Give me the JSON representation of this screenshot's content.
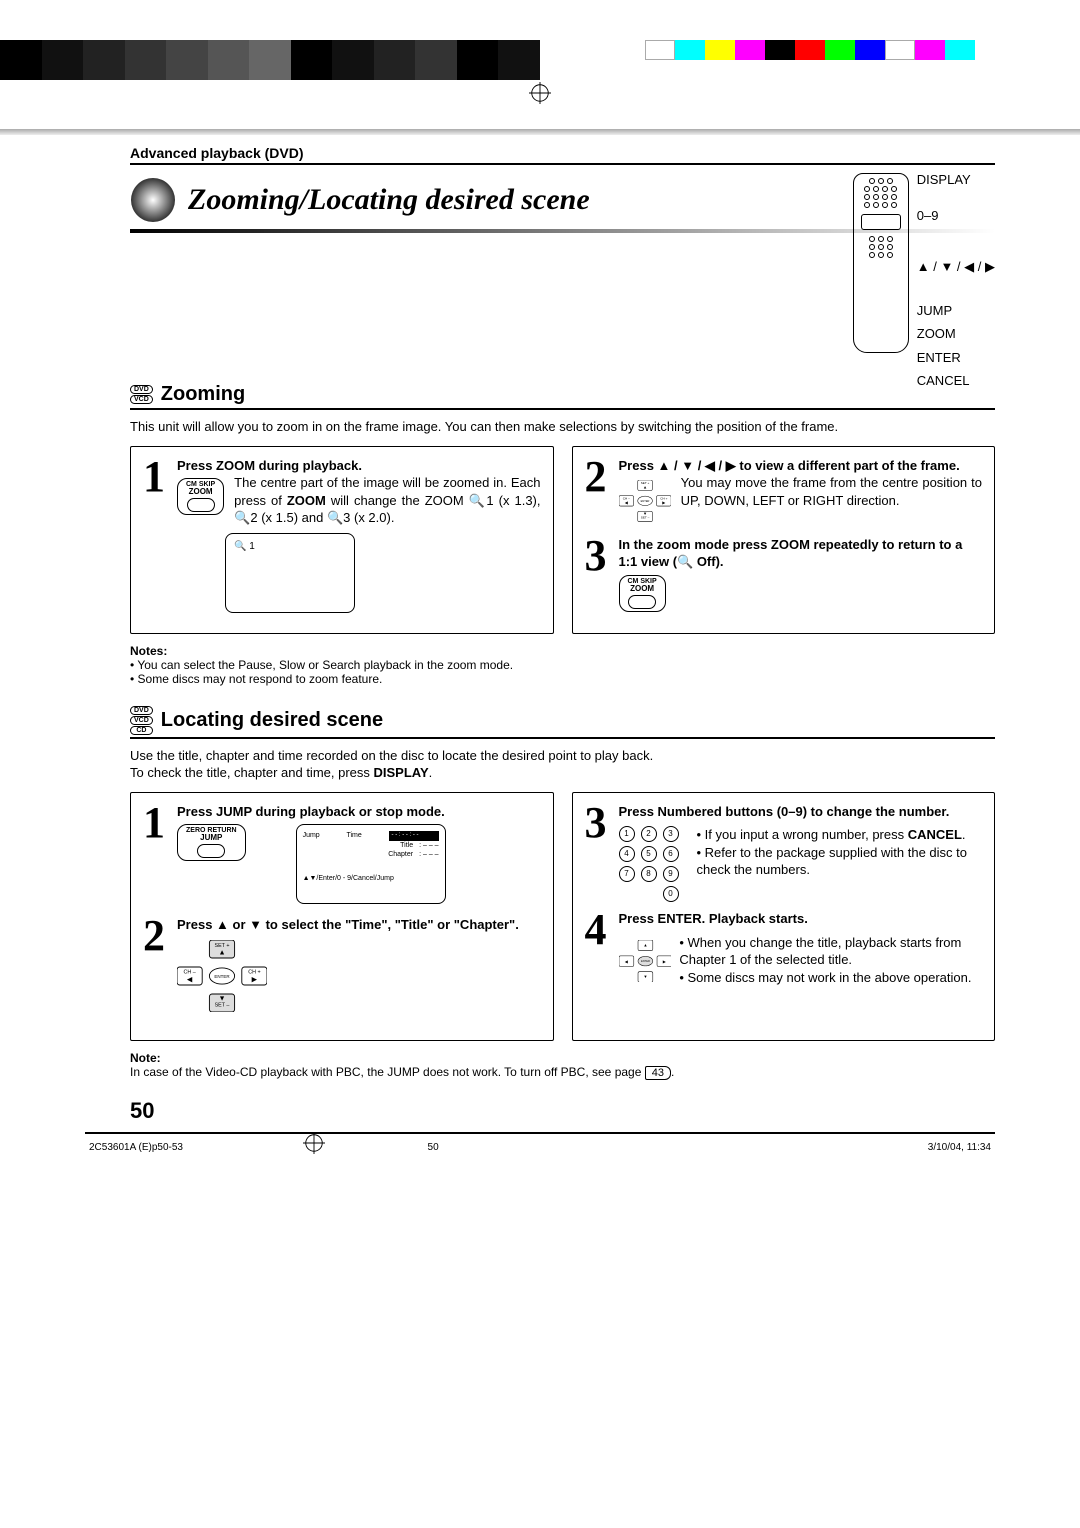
{
  "breadcrumb": "Advanced playback (DVD)",
  "title": "Zooming/Locating desired scene",
  "remote_labels": {
    "display": "DISPLAY",
    "digits": "0–9",
    "dirs": "▲ / ▼ / ◀ / ▶",
    "jump": "JUMP",
    "zoom": "ZOOM",
    "enter": "ENTER",
    "cancel": "CANCEL"
  },
  "discs_zoom": [
    "DVD",
    "VCD"
  ],
  "discs_loc": [
    "DVD",
    "VCD",
    "CD"
  ],
  "section_zoom_title": "Zooming",
  "zoom_intro": "This unit will allow you to zoom in on the frame image. You can then make selections by switching the position of the frame.",
  "zoom_step1_title": "Press ZOOM during playback.",
  "zoom_btn_top": "CM SKIP",
  "zoom_btn_bot": "ZOOM",
  "zoom_step1_body1": "The centre part of the image will be zoomed in.",
  "zoom_step1_body2_a": "Each press of ",
  "zoom_step1_body2_b": "ZOOM",
  "zoom_step1_body2_c": " will change the ZOOM 🔍1 (x 1.3), 🔍2 (x 1.5) and 🔍3 (x 2.0).",
  "zoom_q1": "🔍 1",
  "zoom_step2_title": "Press ▲ / ▼ / ◀ / ▶ to view a different part of the frame.",
  "zoom_step2_body": "You may move the frame from the centre position to UP, DOWN, LEFT or RIGHT direction.",
  "zoom_step3_title": "In the zoom mode press ZOOM repeatedly to return to a 1:1 view (🔍 Off).",
  "nav_labels": {
    "up": "SET +",
    "down": "SET –",
    "left": "CH –",
    "right": "CH +",
    "center": "ENTER"
  },
  "zoom_notes_title": "Notes:",
  "zoom_notes": [
    "You can select the Pause, Slow or Search playback in the zoom mode.",
    "Some discs may not respond to zoom feature."
  ],
  "section_loc_title": "Locating desired scene",
  "loc_intro_a": "Use the title, chapter and time recorded on the disc to locate the desired point to play back.",
  "loc_intro_b_a": "To check the title, chapter and time, press ",
  "loc_intro_b_b": "DISPLAY",
  "loc_intro_b_c": ".",
  "loc_step1_title": "Press JUMP during playback or stop mode.",
  "jump_btn_top": "ZERO RETURN",
  "jump_btn_bot": "JUMP",
  "osd": {
    "head_l": "Jump",
    "head_r": "Time",
    "bar": "- - : - - : - -",
    "title_l": "Title",
    "title_r": ": – – –",
    "chap_l": "Chapter",
    "chap_r": ": – – –",
    "foot": "▲▼/Enter/0 - 9/Cancel/Jump"
  },
  "loc_step2_title": "Press ▲ or ▼ to select the \"Time\", \"Title\" or \"Chapter\".",
  "loc_step3_title": "Press Numbered buttons (0–9) to change the number.",
  "loc_step3_b1_a": "If you input a wrong number, press ",
  "loc_step3_b1_b": "CANCEL",
  "loc_step3_b1_c": ".",
  "loc_step3_b2": "Refer to the package supplied with the disc to check the numbers.",
  "keypad": [
    "1",
    "2",
    "3",
    "4",
    "5",
    "6",
    "7",
    "8",
    "9",
    "0"
  ],
  "loc_step4_title": "Press ENTER. Playback starts.",
  "loc_step4_b1": "When you change the title, playback starts from Chapter 1 of the selected title.",
  "loc_step4_b2": "Some discs may not work in the above operation.",
  "loc_note_title": "Note:",
  "loc_note_a": "In case of the Video-CD playback with PBC, the JUMP does not work. To turn off PBC, see page ",
  "loc_note_pg": "43",
  "loc_note_b": ".",
  "page_number": "50",
  "footer_left": "2C53601A (E)p50-53",
  "footer_mid": "50",
  "footer_right": "3/10/04, 11:34"
}
